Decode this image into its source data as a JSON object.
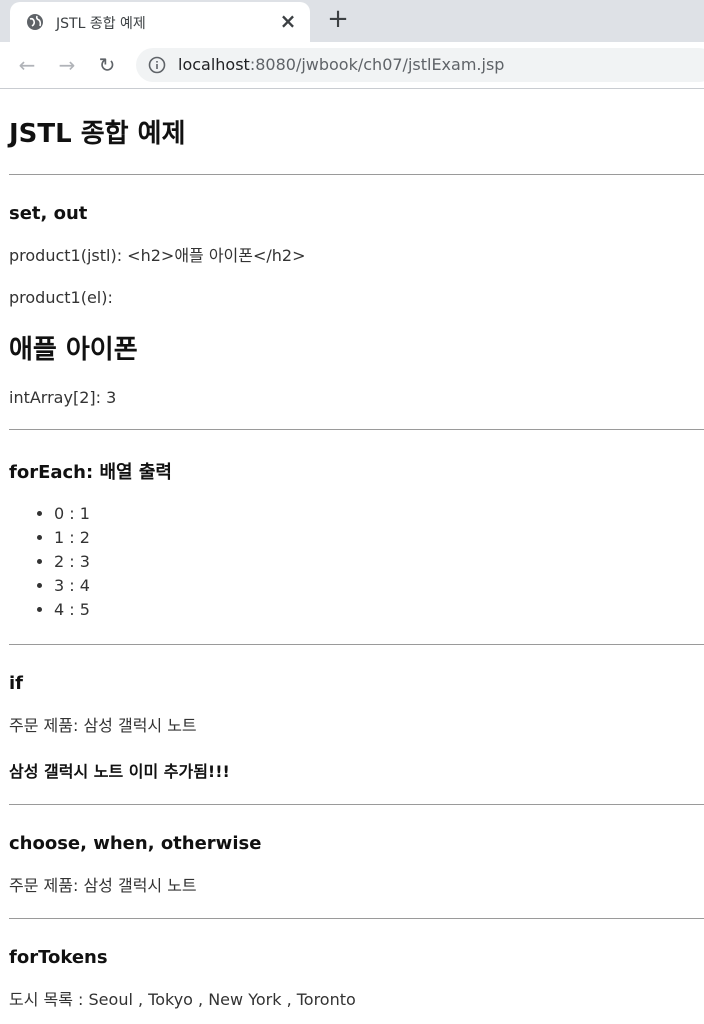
{
  "browser": {
    "tab_title": "JSTL 종합 예제",
    "url_host": "localhost",
    "url_rest": ":8080/jwbook/ch07/jstlExam.jsp"
  },
  "page": {
    "title": "JSTL 종합 예제",
    "set_out": {
      "heading": "set, out",
      "product_jstl": "product1(jstl): <h2>애플 아이폰</h2>",
      "product_el_label": "product1(el):",
      "product_el_value": "애플 아이폰",
      "int_array": "intArray[2]: 3"
    },
    "foreach": {
      "heading": "forEach: 배열 출력",
      "items": [
        "0 : 1",
        "1 : 2",
        "2 : 3",
        "3 : 4",
        "4 : 5"
      ]
    },
    "if": {
      "heading": "if",
      "order": "주문 제품: 삼성 갤럭시 노트",
      "already": "삼성 갤럭시 노트 이미 추가됨!!!"
    },
    "choose": {
      "heading": "choose, when, otherwise",
      "order": "주문 제품: 삼성 갤럭시 노트"
    },
    "fortokens": {
      "heading": "forTokens",
      "cities": "도시 목록 : Seoul , Tokyo , New York , Toronto"
    }
  }
}
